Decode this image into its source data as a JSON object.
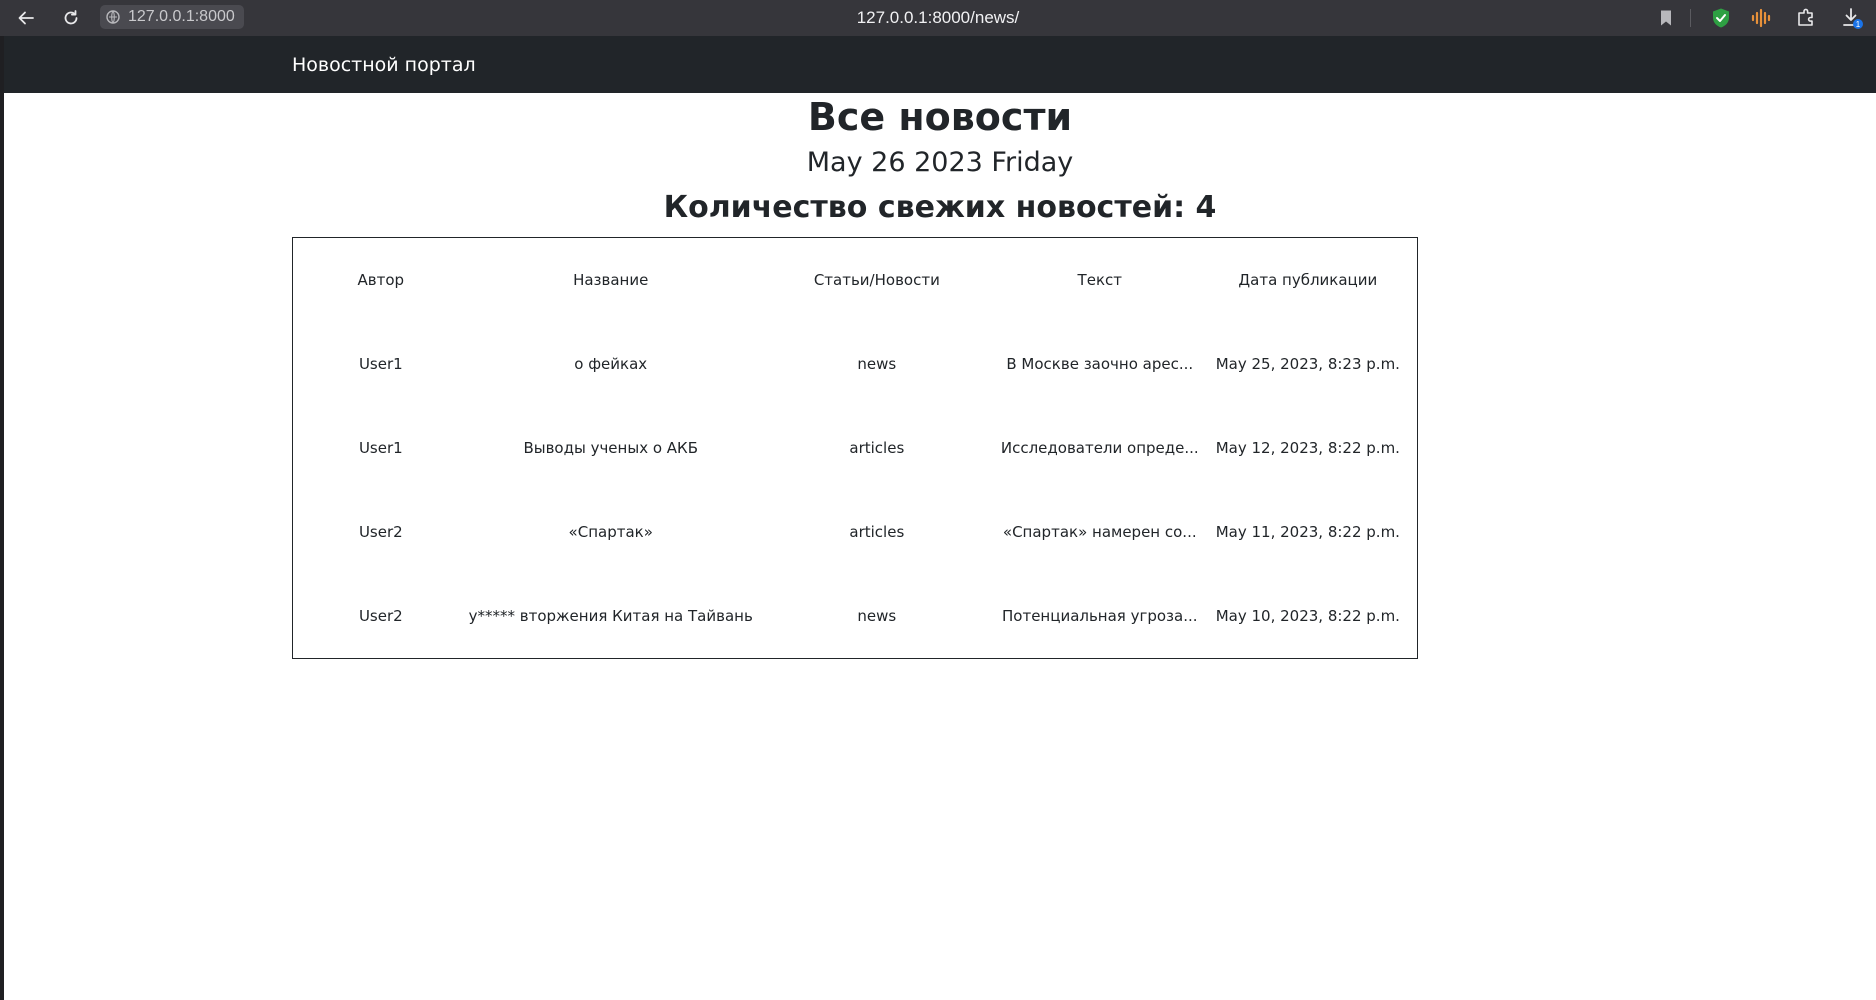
{
  "browser": {
    "site_chip": "127.0.0.1:8000",
    "url": "127.0.0.1:8000/news/",
    "download_badge": "1"
  },
  "nav": {
    "brand": "Новостной портал"
  },
  "page": {
    "title": "Все новости",
    "date": "May 26 2023 Friday",
    "count_text": "Количество свежих новостей: 4"
  },
  "table": {
    "headers": [
      "Автор",
      "Название",
      "Статьи/Новости",
      "Текст",
      "Дата публикации"
    ],
    "rows": [
      [
        "User1",
        "о фейках",
        "news",
        "В Москве заочно арес...",
        "May 25, 2023, 8:23 p.m."
      ],
      [
        "User1",
        "Выводы ученых о АКБ",
        "articles",
        "Исследователи опреде...",
        "May 12, 2023, 8:22 p.m."
      ],
      [
        "User2",
        "«Спартак»",
        "articles",
        "«Спартак» намерен со...",
        "May 11, 2023, 8:22 p.m."
      ],
      [
        "User2",
        "у***** вторжения Китая на Тайвань",
        "news",
        "Потенциальная угроза...",
        "May 10, 2023, 8:22 p.m."
      ]
    ]
  },
  "colors": {
    "browser_bar": "#36363b",
    "site_nav": "#212529",
    "shield_green": "#2ea043",
    "audio_orange": "#e8913a",
    "badge_blue": "#1a73e8"
  },
  "icons": [
    "back-arrow-icon",
    "reload-icon",
    "site-info-icon",
    "bookmark-icon",
    "shield-extension-icon",
    "audio-extension-icon",
    "extensions-puzzle-icon",
    "download-icon"
  ]
}
